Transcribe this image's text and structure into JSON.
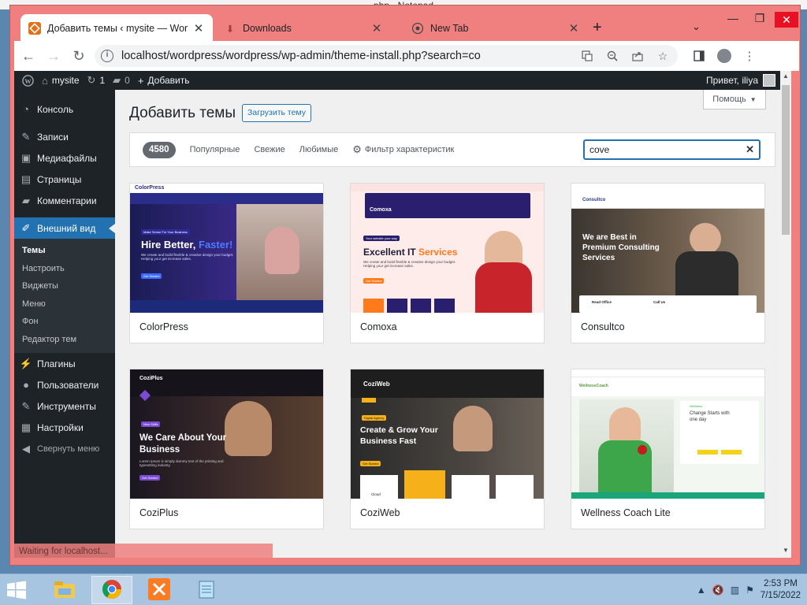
{
  "background_window": {
    "title": "php - Notepad"
  },
  "browser": {
    "tabs": [
      {
        "label": "Добавить темы ‹ mysite — WordPress",
        "icon": "wordpress-icon",
        "active": true
      },
      {
        "label": "Downloads",
        "icon": "download-icon",
        "active": false
      },
      {
        "label": "New Tab",
        "icon": "chrome-icon",
        "active": false
      }
    ],
    "url": "localhost/wordpress/wordpress/wp-admin/theme-install.php?search=co"
  },
  "adminbar": {
    "site_name": "mysite",
    "updates_count": "1",
    "comments_count": "0",
    "new_label": "Добавить",
    "greeting": "Привет, iliya"
  },
  "sidebar": {
    "items": [
      {
        "label": "Консоль",
        "icon": "dashboard-icon"
      },
      {
        "label": "Записи",
        "icon": "pin-icon"
      },
      {
        "label": "Медиафайлы",
        "icon": "media-icon"
      },
      {
        "label": "Страницы",
        "icon": "pages-icon"
      },
      {
        "label": "Комментарии",
        "icon": "comments-icon"
      },
      {
        "label": "Внешний вид",
        "icon": "appearance-icon",
        "active": true
      }
    ],
    "subitems": [
      {
        "label": "Темы",
        "current": true
      },
      {
        "label": "Настроить"
      },
      {
        "label": "Виджеты"
      },
      {
        "label": "Меню"
      },
      {
        "label": "Фон"
      },
      {
        "label": "Редактор тем"
      }
    ],
    "items2": [
      {
        "label": "Плагины",
        "icon": "plugins-icon"
      },
      {
        "label": "Пользователи",
        "icon": "users-icon"
      },
      {
        "label": "Инструменты",
        "icon": "tools-icon"
      },
      {
        "label": "Настройки",
        "icon": "settings-icon"
      }
    ],
    "collapse_label": "Свернуть меню"
  },
  "status_text": "Waiting for localhost...",
  "main": {
    "help_label": "Помощь",
    "title": "Добавить темы",
    "upload_label": "Загрузить тему",
    "count": "4580",
    "filter_tabs": [
      "Популярные",
      "Свежие",
      "Любимые"
    ],
    "feature_filter_label": "Фильтр характеристик",
    "search_value": "cove",
    "themes": [
      {
        "name": "ColorPress",
        "preview_brand": "ColorPress",
        "preview_tag": "Make Sense For Your Business",
        "preview_headline_1": "Hire Better,",
        "preview_headline_2": "Faster!",
        "preview_body": "We create and build flexible & creative design your budget. Helping your get increase sales.",
        "preview_button": "Get Started"
      },
      {
        "name": "Comoxa",
        "preview_brand": "Comoxa",
        "preview_tag": "Your website your way",
        "preview_headline_1": "Excellent IT",
        "preview_headline_2": "Services",
        "preview_body": "We create and build flexible & creative design your budget. Helping your get increase sales.",
        "preview_button": "Get Started"
      },
      {
        "name": "Consultco",
        "preview_brand": "Consultco",
        "preview_tag": "We are Best in",
        "preview_headline_1": "Premium Consulting",
        "preview_headline_2": "Services",
        "preview_body": "Read Office",
        "preview_button": "Call Us"
      },
      {
        "name": "CoziPlus",
        "preview_brand": "CoziPlus",
        "preview_tag": "New Skills",
        "preview_headline_1": "We Care About Your",
        "preview_headline_2": "Business",
        "preview_body": "Lorem Ipsum is simply dummy text of the printing and typesetting industry.",
        "preview_button": "Get Started"
      },
      {
        "name": "CoziWeb",
        "preview_brand": "CoziWeb",
        "preview_tag": "Digital Agency",
        "preview_headline_1": "Create & Grow Your",
        "preview_headline_2": "Business Fast",
        "preview_body": "Cloud",
        "preview_button": "Get Started"
      },
      {
        "name": "Wellness Coach Lite",
        "preview_brand": "WellnessCoach",
        "preview_tag": "Wellness",
        "preview_headline_1": "Change Starts with",
        "preview_headline_2": "one day",
        "preview_body": "",
        "preview_button": ""
      }
    ]
  },
  "taskbar": {
    "time": "2:53 PM",
    "date": "7/15/2022"
  },
  "colors": {
    "wp_dark": "#1d2327",
    "wp_blue": "#2271b1",
    "browser_frame": "#f08080",
    "taskbar": "#a7c4e0"
  }
}
